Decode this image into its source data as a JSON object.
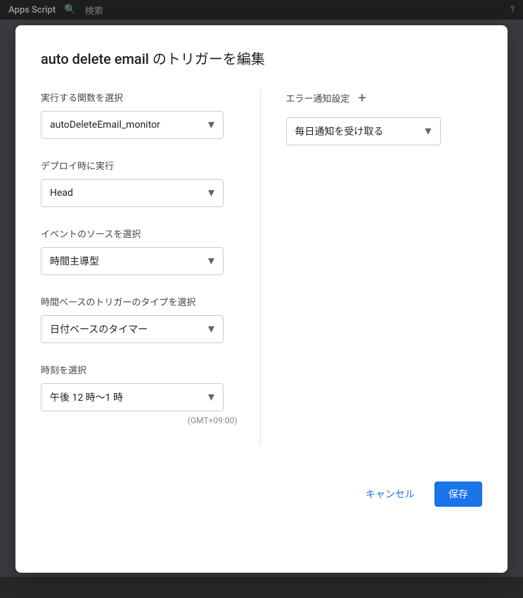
{
  "topBar": {
    "title": "Apps Script",
    "searchIcon": "🔍",
    "searchLabel": "検索",
    "helpIcon": "?"
  },
  "dialog": {
    "title": "auto delete email のトリガーを編集",
    "leftCol": {
      "functionField": {
        "label": "実行する関数を選択",
        "value": "autoDeleteEmail_monitor",
        "chevron": "▾"
      },
      "deployField": {
        "label": "デプロイ時に実行",
        "value": "Head",
        "chevron": "▾"
      },
      "eventSourceField": {
        "label": "イベントのソースを選択",
        "value": "時間主導型",
        "chevron": "▾"
      },
      "triggerTypeField": {
        "label": "時間ベースのトリガーのタイプを選択",
        "value": "日付ベースのタイマー",
        "chevron": "▾"
      },
      "timeField": {
        "label": "時刻を選択",
        "value": "午後 12 時〜1 時",
        "chevron": "▾",
        "gmt": "(GMT+09:00)"
      }
    },
    "rightCol": {
      "errorLabel": "エラー通知設定",
      "plusIcon": "+",
      "notificationField": {
        "value": "毎日通知を受け取る",
        "chevron": "▾"
      }
    },
    "footer": {
      "cancelLabel": "キャンセル",
      "saveLabel": "保存"
    }
  }
}
